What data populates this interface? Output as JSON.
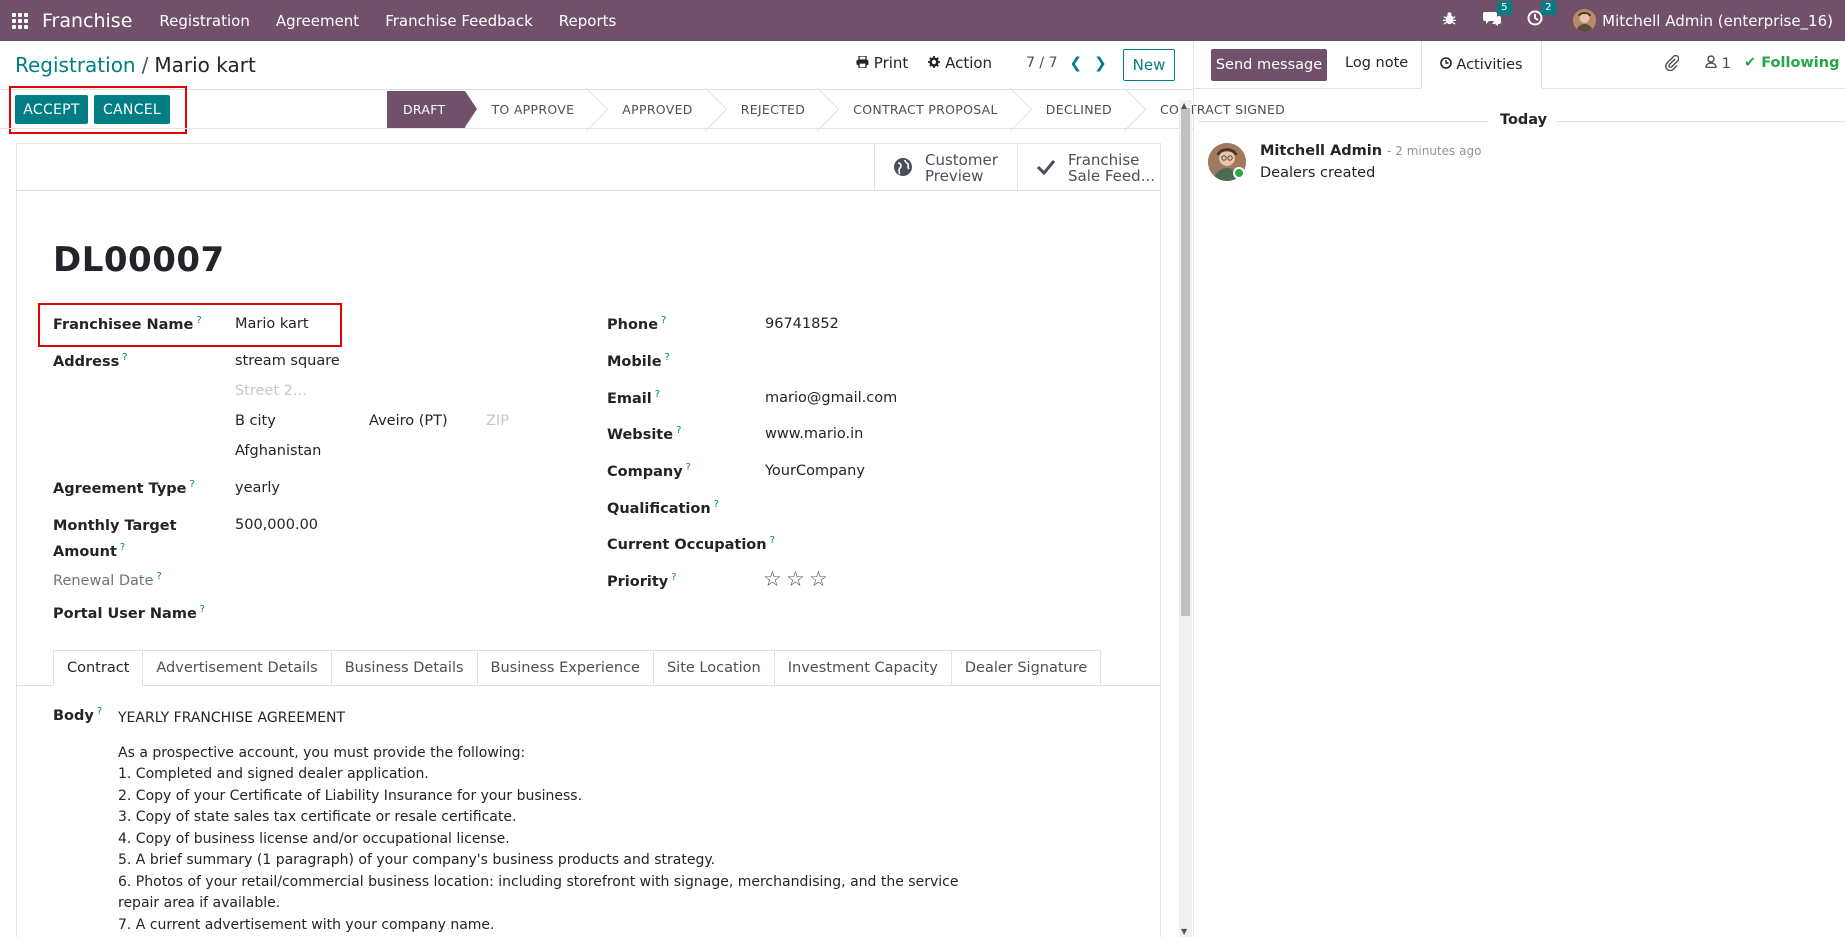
{
  "navbar": {
    "app_name": "Franchise",
    "menu": [
      "Registration",
      "Agreement",
      "Franchise Feedback",
      "Reports"
    ],
    "messages_count": "5",
    "activities_count": "2",
    "user": "Mitchell Admin (enterprise_16)"
  },
  "control_panel": {
    "breadcrumb_parent": "Registration",
    "breadcrumb_current": "Mario kart",
    "print_label": "Print",
    "action_label": "Action",
    "pager": "7 / 7",
    "new_label": "New"
  },
  "statusbar": {
    "accept_label": "ACCEPT",
    "cancel_label": "CANCEL",
    "stages": [
      "DRAFT",
      "TO APPROVE",
      "APPROVED",
      "REJECTED",
      "CONTRACT PROPOSAL",
      "DECLINED",
      "CONTRACT SIGNED"
    ],
    "active_stage": "DRAFT"
  },
  "smart_buttons": {
    "customer_preview_line1": "Customer",
    "customer_preview_line2": "Preview",
    "feedback_line1": "Franchise",
    "feedback_line2": "Sale Feed..."
  },
  "record": {
    "reference": "DL00007",
    "fields_left": {
      "franchisee_name_label": "Franchisee Name",
      "franchisee_name": "Mario kart",
      "address_label": "Address",
      "street": "stream square",
      "street2_placeholder": "Street 2...",
      "city": "B city",
      "state": "Aveiro (PT)",
      "zip_placeholder": "ZIP",
      "country": "Afghanistan",
      "agreement_type_label": "Agreement Type",
      "agreement_type": "yearly",
      "monthly_target_label_1": "Monthly Target",
      "monthly_target_label_2": "Amount",
      "monthly_target": "500,000.00",
      "renewal_date_label": "Renewal Date",
      "portal_user_label": "Portal User Name"
    },
    "fields_right": {
      "phone_label": "Phone",
      "phone": "96741852",
      "mobile_label": "Mobile",
      "email_label": "Email",
      "email": "mario@gmail.com",
      "website_label": "Website",
      "website": "www.mario.in",
      "company_label": "Company",
      "company": "YourCompany",
      "qualification_label": "Qualification",
      "current_occupation_label": "Current Occupation",
      "priority_label": "Priority",
      "priority_stars": 0
    }
  },
  "tabs": [
    "Contract",
    "Advertisement Details",
    "Business Details",
    "Business Experience",
    "Site Location",
    "Investment Capacity",
    "Dealer Signature"
  ],
  "contract": {
    "body_label": "Body",
    "lines": [
      "YEARLY FRANCHISE AGREEMENT",
      "",
      "As a prospective account, you must provide the following:",
      "1. Completed and signed dealer application.",
      "2. Copy of your Certificate of Liability Insurance for your business.",
      "3. Copy of state sales tax certificate or resale certificate.",
      "4. Copy of business license and/or occupational license.",
      "5. A brief summary (1 paragraph) of your company's business products and strategy.",
      "6. Photos of your retail/commercial business location: including storefront with signage, merchandising, and the service",
      "repair area if available.",
      "7. A current advertisement with your company name."
    ]
  },
  "chatter": {
    "send_message_label": "Send message",
    "log_note_label": "Log note",
    "activities_label": "Activities",
    "followers_count": "1",
    "following_label": "Following",
    "today_label": "Today",
    "message_author": "Mitchell Admin",
    "message_time": "- 2 minutes ago",
    "message_body": "Dealers created"
  }
}
